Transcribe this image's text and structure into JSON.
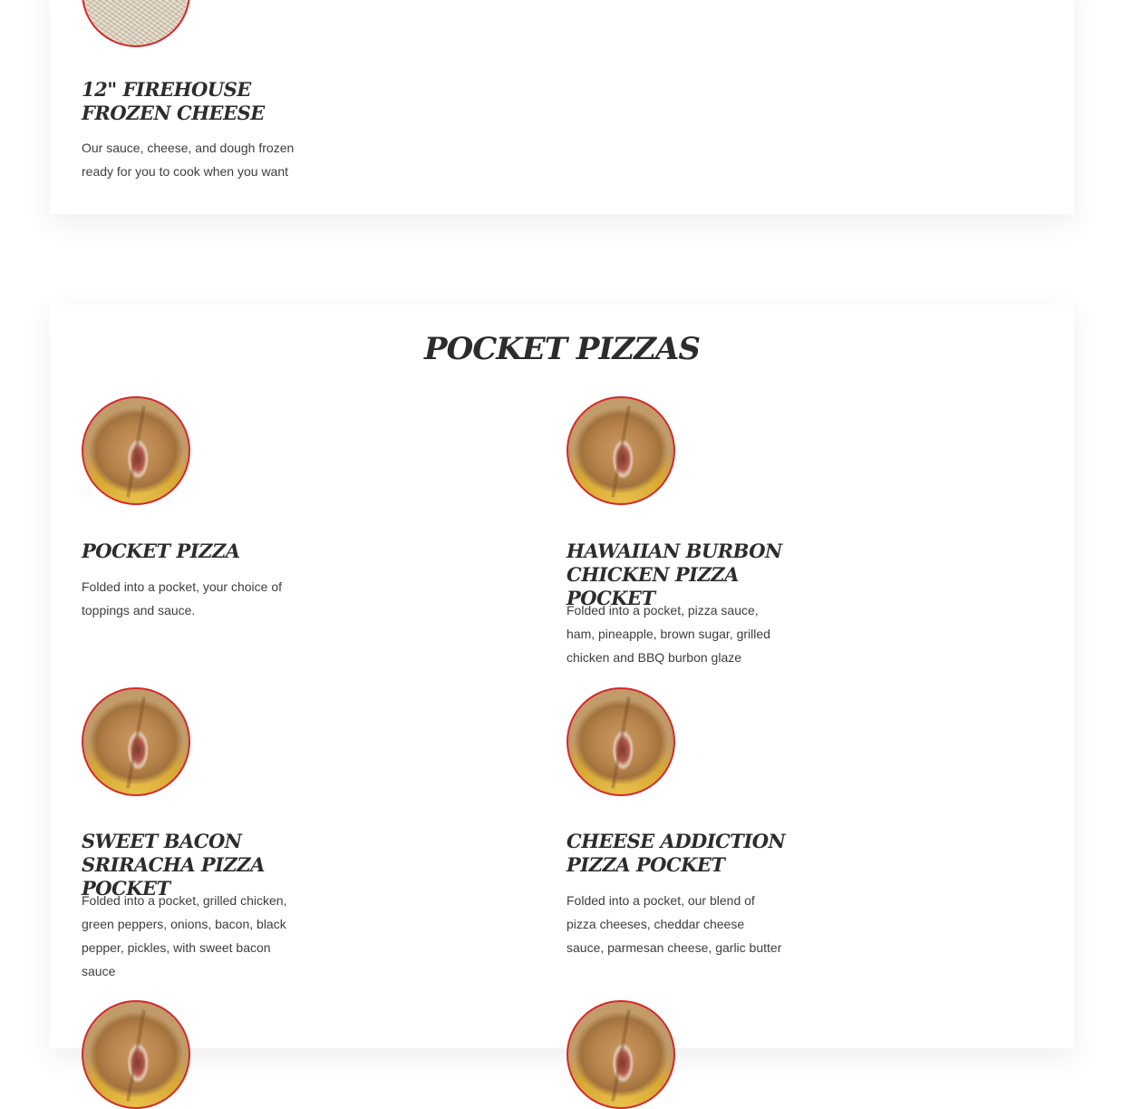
{
  "top_item": {
    "title": "12\" Firehouse Frozen Cheese",
    "description": "Our sauce, cheese, and dough frozen ready for you to cook when you want"
  },
  "pocket_section": {
    "title": "Pocket Pizzas",
    "items": [
      {
        "title": "Pocket Pizza",
        "description": "Folded into a pocket, your choice of toppings and sauce."
      },
      {
        "title": "Hawaiian Burbon Chicken Pizza Pocket",
        "description": "Folded into a pocket, pizza sauce, ham, pineapple, brown sugar, grilled chicken and BBQ burbon glaze"
      },
      {
        "title": "Sweet Bacon Sriracha Pizza Pocket",
        "description": "Folded into a pocket, grilled chicken, green peppers, onions, bacon, black pepper, pickles, with sweet bacon sauce"
      },
      {
        "title": "Cheese Addiction Pizza Pocket",
        "description": "Folded into a pocket, our blend of pizza cheeses, cheddar cheese sauce, parmesan cheese, garlic butter"
      }
    ]
  },
  "colors": {
    "accent_border": "#d42a2a",
    "title_text": "#2c2c2c",
    "body_text": "#3d3d3d"
  }
}
